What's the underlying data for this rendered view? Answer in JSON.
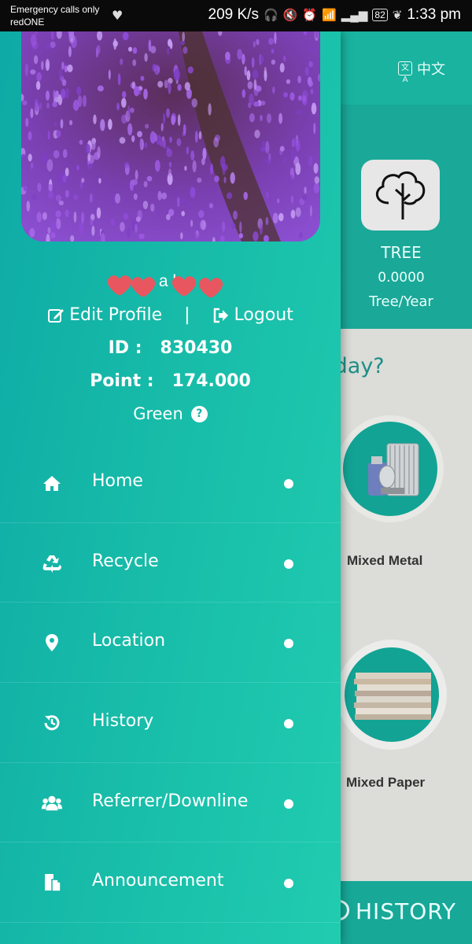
{
  "status_bar": {
    "carrier_line1": "Emergency calls only",
    "carrier_line2": "redONE",
    "speed": "209 K/s",
    "battery": "82",
    "time": "1:33 pm"
  },
  "background": {
    "language_label": "中文",
    "language_icon_text": "文A",
    "stat_label": "TREE",
    "stat_value": "0.0000",
    "stat_unit": "Tree/Year",
    "question_partial": "cle today?",
    "items": [
      {
        "label": "Mixed Metal"
      },
      {
        "label": "Mixed Paper"
      }
    ],
    "history_button": "HISTORY"
  },
  "drawer": {
    "user_name": "a h",
    "edit_profile": "Edit Profile",
    "separator": "|",
    "logout": "Logout",
    "id_label": "ID :",
    "id_value": "830430",
    "point_label": "Point :",
    "point_value": "174.000",
    "level": "Green",
    "help_icon_text": "?",
    "menu": [
      {
        "label": "Home",
        "icon": "home-icon"
      },
      {
        "label": "Recycle",
        "icon": "recycle-icon"
      },
      {
        "label": "Location",
        "icon": "location-pin-icon"
      },
      {
        "label": "History",
        "icon": "history-icon"
      },
      {
        "label": "Referrer/Downline",
        "icon": "users-icon"
      },
      {
        "label": "Announcement",
        "icon": "announcement-icon"
      }
    ]
  },
  "colors": {
    "drawer_start": "#0eaaa6",
    "drawer_end": "#20ccb0",
    "accent": "#19b3a0",
    "question_text": "#1b8f86"
  }
}
